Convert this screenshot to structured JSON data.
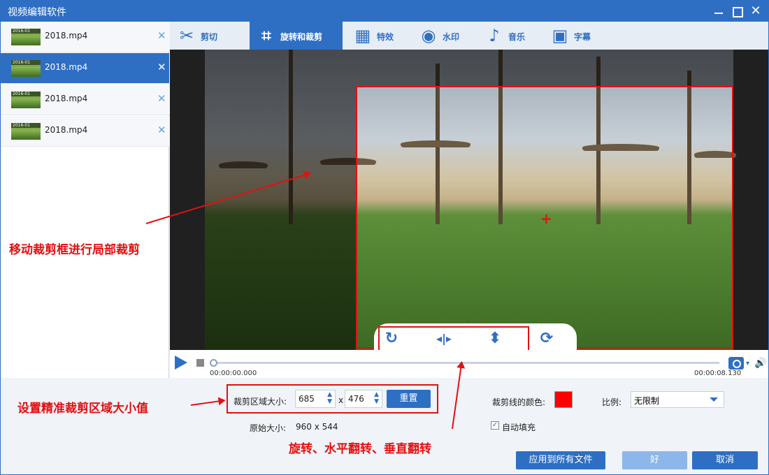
{
  "window": {
    "title": "视频编辑软件",
    "minimize_label": "",
    "close_label": "✕"
  },
  "files": [
    {
      "name": "2018.mp4",
      "thumb_text": "2016-01",
      "active": false
    },
    {
      "name": "2018.mp4",
      "thumb_text": "2016-01",
      "active": true
    },
    {
      "name": "2018.mp4",
      "thumb_text": "2016-01",
      "active": false
    },
    {
      "name": "2018.mp4",
      "thumb_text": "2016-01",
      "active": false
    }
  ],
  "file_close_glyph": "✕",
  "tabs": [
    {
      "label": "剪切",
      "icon": "scissors-icon",
      "glyph": "✂"
    },
    {
      "label": "旋转和裁剪",
      "icon": "crop-icon",
      "glyph": "⌗"
    },
    {
      "label": "特效",
      "icon": "effects-film-icon",
      "glyph": "▦"
    },
    {
      "label": "水印",
      "icon": "watermark-icon",
      "glyph": "◉"
    },
    {
      "label": "音乐",
      "icon": "music-note-icon",
      "glyph": "♪"
    },
    {
      "label": "字幕",
      "icon": "subtitle-icon",
      "glyph": "▣"
    }
  ],
  "preview": {
    "crosshair": "+"
  },
  "controls": {
    "rotate": "↻",
    "flip_h": "◂|▸",
    "flip_v": "⬍",
    "reset_rotate": "⟳",
    "chevron": "⌃"
  },
  "playback": {
    "current_time": "00:00:00.000",
    "total_time": "00:00:08.130",
    "volume_glyph": "🔊",
    "cam_caret": "▾"
  },
  "annotations": {
    "move_crop": "移动裁剪框进行局部裁剪",
    "set_size": "设置精准裁剪区域大小值",
    "rotate_flip": "旋转、水平翻转、垂直翻转"
  },
  "crop_settings": {
    "size_label": "裁剪区域大小:",
    "width": "685",
    "height": "476",
    "x_sep": "x",
    "reset_label": "重置",
    "original_label": "原始大小:",
    "original_value": "960 x 544",
    "line_color_label": "裁剪线的颜色:",
    "line_color": "#ff0000",
    "ratio_label": "比例:",
    "ratio_value": "无限制",
    "auto_fill_label": "自动填充",
    "auto_fill_checked": "✓"
  },
  "footer": {
    "apply_all": "应用到所有文件",
    "ok": "好",
    "cancel": "取消"
  }
}
